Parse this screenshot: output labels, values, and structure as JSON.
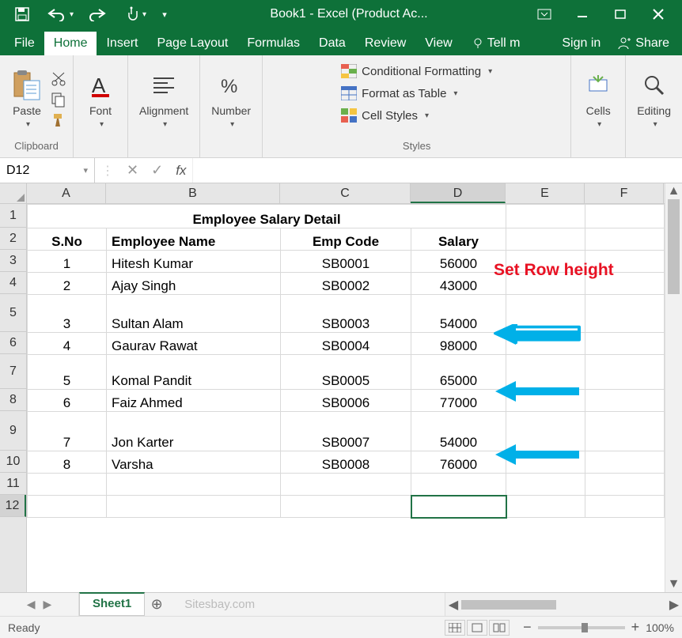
{
  "title": "Book1 - Excel (Product Ac...",
  "tabs": [
    "File",
    "Home",
    "Insert",
    "Page Layout",
    "Formulas",
    "Data",
    "Review",
    "View"
  ],
  "tellme": "Tell m",
  "signin": "Sign in",
  "share": "Share",
  "ribbon": {
    "clipboard": "Clipboard",
    "paste": "Paste",
    "font": "Font",
    "alignment": "Alignment",
    "number": "Number",
    "styles": "Styles",
    "cond": "Conditional Formatting",
    "fmttable": "Format as Table",
    "cellstyles": "Cell Styles",
    "cells": "Cells",
    "editing": "Editing"
  },
  "namebox": "D12",
  "fx": "fx",
  "columns": [
    "A",
    "B",
    "C",
    "D",
    "E",
    "F"
  ],
  "rows": [
    "1",
    "2",
    "3",
    "4",
    "5",
    "6",
    "7",
    "8",
    "9",
    "10",
    "11",
    "12"
  ],
  "data": {
    "r1_title": "Employee Salary Detail",
    "r2_sno": "S.No",
    "r2_name": "Employee Name",
    "r2_code": "Emp Code",
    "r2_salary": "Salary",
    "r3_sno": "1",
    "r3_name": "Hitesh Kumar",
    "r3_code": "SB0001",
    "r3_salary": "56000",
    "r4_sno": "2",
    "r4_name": "Ajay Singh",
    "r4_code": "SB0002",
    "r4_salary": "43000",
    "r5_sno": "3",
    "r5_name": "Sultan Alam",
    "r5_code": "SB0003",
    "r5_salary": "54000",
    "r6_sno": "4",
    "r6_name": "Gaurav Rawat",
    "r6_code": "SB0004",
    "r6_salary": "98000",
    "r7_sno": "5",
    "r7_name": "Komal Pandit",
    "r7_code": "SB0005",
    "r7_salary": "65000",
    "r8_sno": "6",
    "r8_name": "Faiz Ahmed",
    "r8_code": "SB0006",
    "r8_salary": "77000",
    "r9_sno": "7",
    "r9_name": "Jon Karter",
    "r9_code": "SB0007",
    "r9_salary": "54000",
    "r10_sno": "8",
    "r10_name": "Varsha",
    "r10_code": "SB0008",
    "r10_salary": "76000"
  },
  "annotation": "Set Row height",
  "sheet": "Sheet1",
  "watermark": "Sitesbay.com",
  "status": "Ready",
  "zoom": "100%",
  "colwidths": {
    "A": 100,
    "B": 220,
    "C": 165,
    "D": 120,
    "E": 100,
    "F": 100
  },
  "chart_data": {
    "type": "table",
    "title": "Employee Salary Detail",
    "columns": [
      "S.No",
      "Employee Name",
      "Emp Code",
      "Salary"
    ],
    "rows": [
      [
        1,
        "Hitesh Kumar",
        "SB0001",
        56000
      ],
      [
        2,
        "Ajay Singh",
        "SB0002",
        43000
      ],
      [
        3,
        "Sultan Alam",
        "SB0003",
        54000
      ],
      [
        4,
        "Gaurav Rawat",
        "SB0004",
        98000
      ],
      [
        5,
        "Komal Pandit",
        "SB0005",
        65000
      ],
      [
        6,
        "Faiz Ahmed",
        "SB0006",
        77000
      ],
      [
        7,
        "Jon Karter",
        "SB0007",
        54000
      ],
      [
        8,
        "Varsha",
        "SB0008",
        76000
      ]
    ]
  }
}
